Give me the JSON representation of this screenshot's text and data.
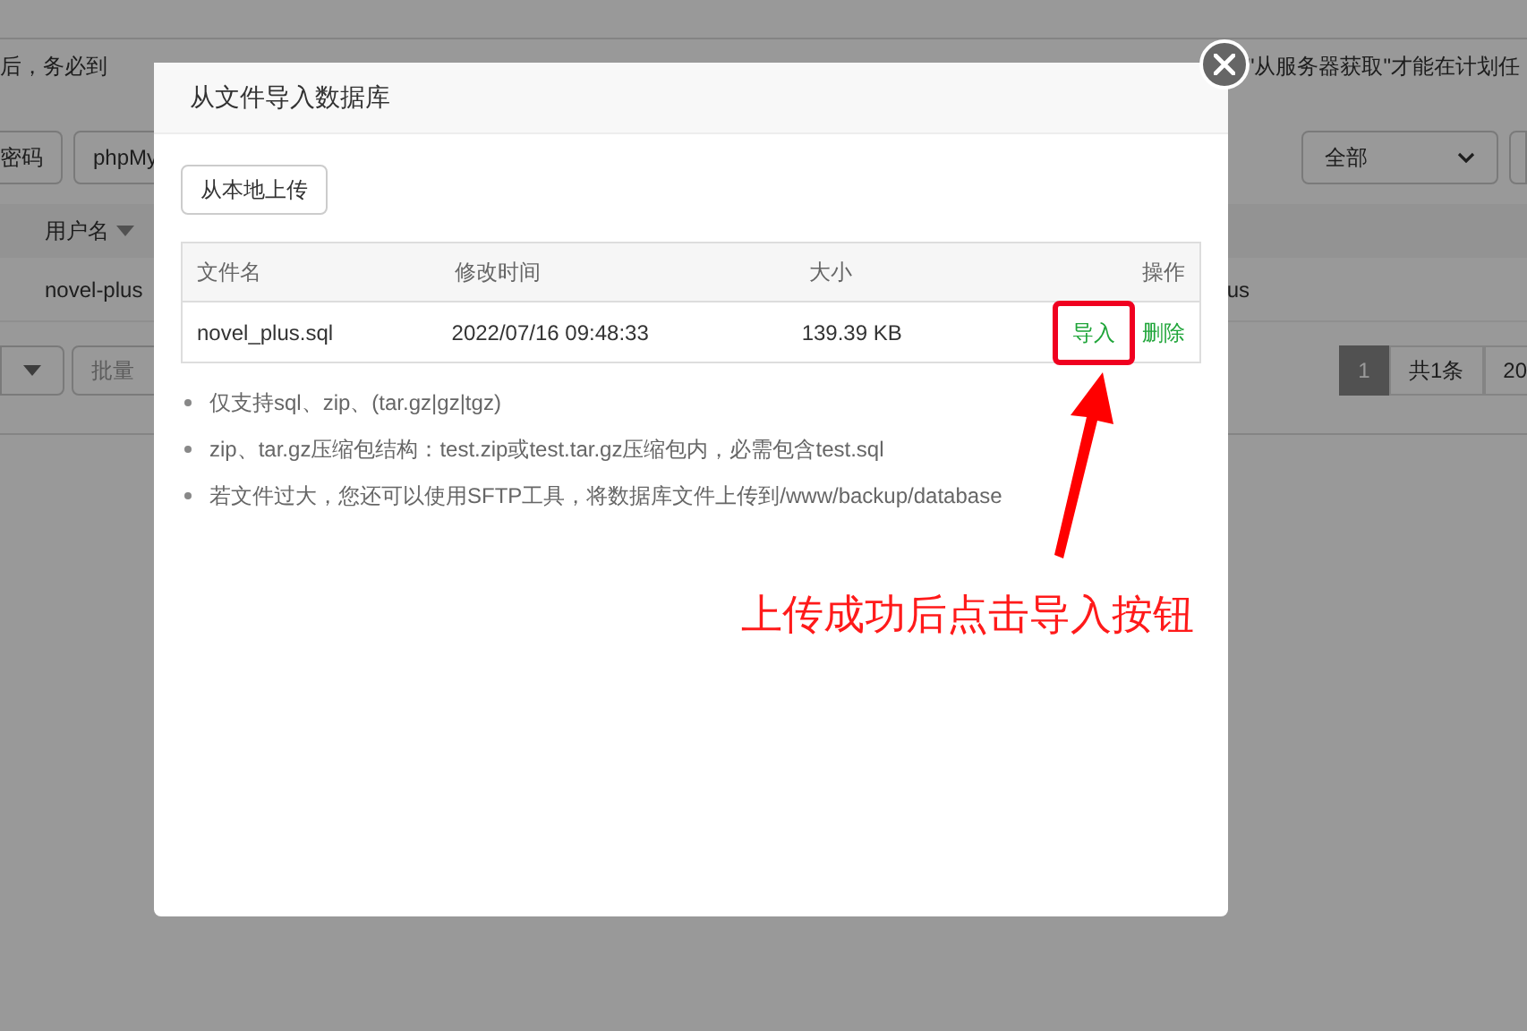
{
  "background": {
    "notice_left": "后，务必到",
    "notice_right": "\"从服务器获取\"才能在计划任",
    "buttons_left": [
      "密码",
      "phpMy"
    ],
    "filter_select": "全部",
    "column_header": "用户名",
    "row_cell_left": "novel-plus",
    "row_cell_right": "us",
    "batch_select": "批量",
    "pagination": {
      "page": "1",
      "total": "共1条",
      "per_page": "20"
    }
  },
  "modal": {
    "title": "从文件导入数据库",
    "upload_button": "从本地上传",
    "table": {
      "columns": [
        "文件名",
        "修改时间",
        "大小",
        "操作"
      ],
      "rows": [
        {
          "cells": [
            "novel_plus.sql",
            "2022/07/16 09:48:33",
            "139.39 KB"
          ],
          "actions": [
            "导入",
            "删除"
          ]
        }
      ]
    },
    "notes": [
      "仅支持sql、zip、(tar.gz|gz|tgz)",
      "zip、tar.gz压缩包结构：test.zip或test.tar.gz压缩包内，必需包含test.sql",
      "若文件过大，您还可以使用SFTP工具，将数据库文件上传到/www/backup/database"
    ]
  },
  "annotation": {
    "text": "上传成功后点击导入按钮"
  }
}
